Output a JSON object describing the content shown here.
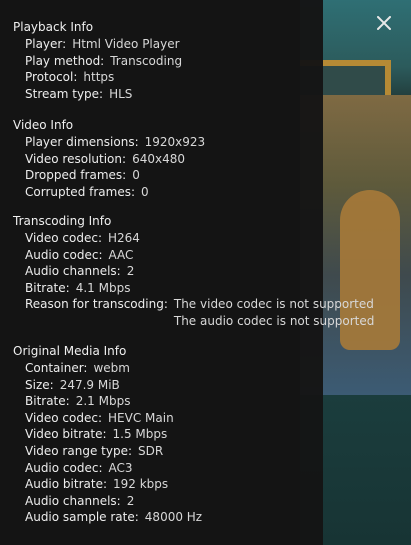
{
  "playback": {
    "title": "Playback Info",
    "rows": [
      {
        "label": "Player:",
        "value": "Html Video Player"
      },
      {
        "label": "Play method:",
        "value": "Transcoding"
      },
      {
        "label": "Protocol:",
        "value": "https"
      },
      {
        "label": "Stream type:",
        "value": "HLS"
      }
    ]
  },
  "video": {
    "title": "Video Info",
    "rows": [
      {
        "label": "Player dimensions:",
        "value": "1920x923"
      },
      {
        "label": "Video resolution:",
        "value": "640x480"
      },
      {
        "label": "Dropped frames:",
        "value": "0"
      },
      {
        "label": "Corrupted frames:",
        "value": "0"
      }
    ]
  },
  "transcoding": {
    "title": "Transcoding Info",
    "rows": [
      {
        "label": "Video codec:",
        "value": "H264"
      },
      {
        "label": "Audio codec:",
        "value": "AAC"
      },
      {
        "label": "Audio channels:",
        "value": "2"
      },
      {
        "label": "Bitrate:",
        "value": "4.1 Mbps"
      }
    ],
    "reason_label": "Reason for transcoding:",
    "reasons": [
      "The video codec is not supported",
      "The audio codec is not supported"
    ]
  },
  "original": {
    "title": "Original Media Info",
    "rows": [
      {
        "label": "Container:",
        "value": "webm"
      },
      {
        "label": "Size:",
        "value": "247.9 MiB"
      },
      {
        "label": "Bitrate:",
        "value": "2.1 Mbps"
      },
      {
        "label": "Video codec:",
        "value": "HEVC Main"
      },
      {
        "label": "Video bitrate:",
        "value": "1.5 Mbps"
      },
      {
        "label": "Video range type:",
        "value": "SDR"
      },
      {
        "label": "Audio codec:",
        "value": "AC3"
      },
      {
        "label": "Audio bitrate:",
        "value": "192 kbps"
      },
      {
        "label": "Audio channels:",
        "value": "2"
      },
      {
        "label": "Audio sample rate:",
        "value": "48000 Hz"
      }
    ]
  },
  "close_icon": "close-icon",
  "colors": {
    "panel": "#151515",
    "text": "#e6e6e6"
  }
}
